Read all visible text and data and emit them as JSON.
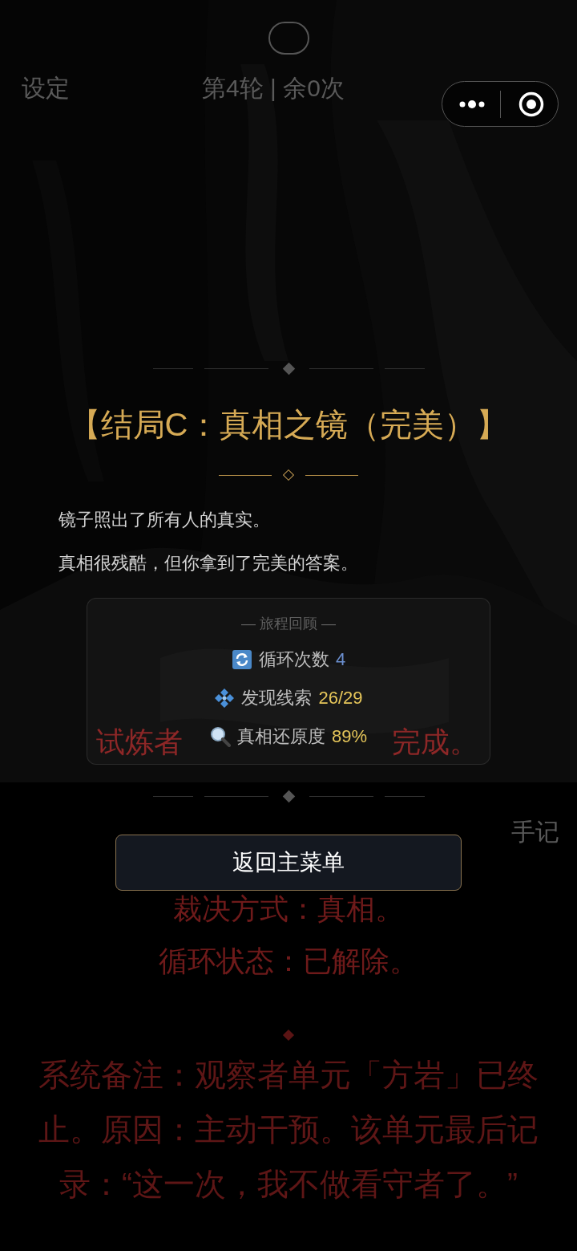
{
  "background": {
    "top_bar": {
      "left": "设定",
      "center": "第4轮 | 余0次"
    },
    "trial_line": [
      "试炼者",
      "完成。"
    ],
    "notes_button": "手记",
    "verdict_lines": [
      "裁决方式：真相。",
      "循环状态：已解除。"
    ],
    "system_note": "系统备注：观察者单元「方岩」已终止。原因：主动干预。该单元最后记录：“这一次，我不做看守者了。”"
  },
  "ending": {
    "title": "【结局C：真相之镜（完美）】",
    "paragraphs": [
      "镜子照出了所有人的真实。",
      "真相很残酷，但你拿到了完美的答案。"
    ],
    "review": {
      "heading": "— 旅程回顾 —",
      "stats": [
        {
          "kind": "loop",
          "label": "循环次数",
          "value": "4",
          "color": "#6b8fcf"
        },
        {
          "kind": "clue",
          "label": "发现线索",
          "value": "26/29",
          "color": "#e6c65a"
        },
        {
          "kind": "truth",
          "label": "真相还原度",
          "value": "89%",
          "color": "#e6c65a"
        }
      ]
    },
    "button": "返回主菜单"
  }
}
